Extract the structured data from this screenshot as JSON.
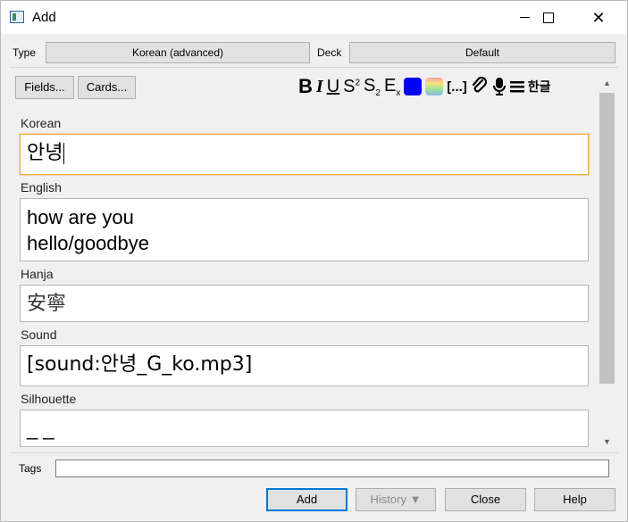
{
  "window": {
    "title": "Add"
  },
  "header": {
    "type_label": "Type",
    "type_value": "Korean (advanced)",
    "deck_label": "Deck",
    "deck_value": "Default"
  },
  "buttons": {
    "fields": "Fields...",
    "cards": "Cards..."
  },
  "toolbar": {
    "bold": "B",
    "italic": "I",
    "underline": "U",
    "superscript": "S",
    "subscript": "S",
    "clear_format": "E",
    "cloze": "[...]",
    "hangul": "한글",
    "text_color": "#0000ff",
    "icons": [
      "bold-icon",
      "italic-icon",
      "underline-icon",
      "superscript-icon",
      "subscript-icon",
      "clear-format-icon",
      "text-color-icon",
      "highlight-color-icon",
      "cloze-icon",
      "attach-icon",
      "record-audio-icon",
      "more-icon"
    ]
  },
  "fields": [
    {
      "label": "Korean",
      "value": "안녕"
    },
    {
      "label": "English",
      "value_lines": [
        "how are you",
        "hello/goodbye"
      ]
    },
    {
      "label": "Hanja",
      "value": "安寧"
    },
    {
      "label": "Sound",
      "value": "[sound:안녕_G_ko.mp3]"
    },
    {
      "label": "Silhouette",
      "value": "_ _"
    }
  ],
  "tags": {
    "label": "Tags",
    "value": ""
  },
  "footer": {
    "add": "Add",
    "history": "History ▼",
    "close": "Close",
    "help": "Help"
  }
}
